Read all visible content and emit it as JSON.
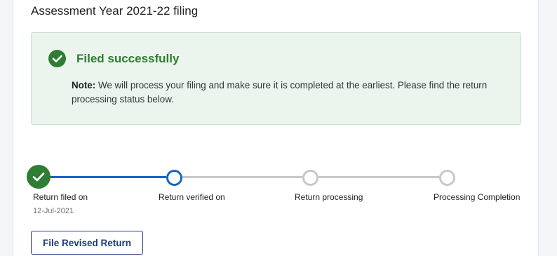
{
  "header": {
    "title": "Assessment Year 2021-22 filing"
  },
  "status_banner": {
    "title": "Filed successfully",
    "note_label": "Note:",
    "note_text": " We will process your filing and make sure it is completed at the earliest. Please find the return processing status below.",
    "icon": "check-circle-icon",
    "color": "#2e7d32"
  },
  "stepper": {
    "steps": [
      {
        "label": "Return filed on",
        "date": "12-Jul-2021",
        "state": "completed"
      },
      {
        "label": "Return verified on",
        "state": "current"
      },
      {
        "label": "Return processing",
        "state": "pending"
      },
      {
        "label": "Processing Completion",
        "state": "pending"
      }
    ],
    "accent_color": "#1565c0",
    "completed_color": "#2e7d32"
  },
  "actions": {
    "revise_label": "File Revised Return"
  }
}
